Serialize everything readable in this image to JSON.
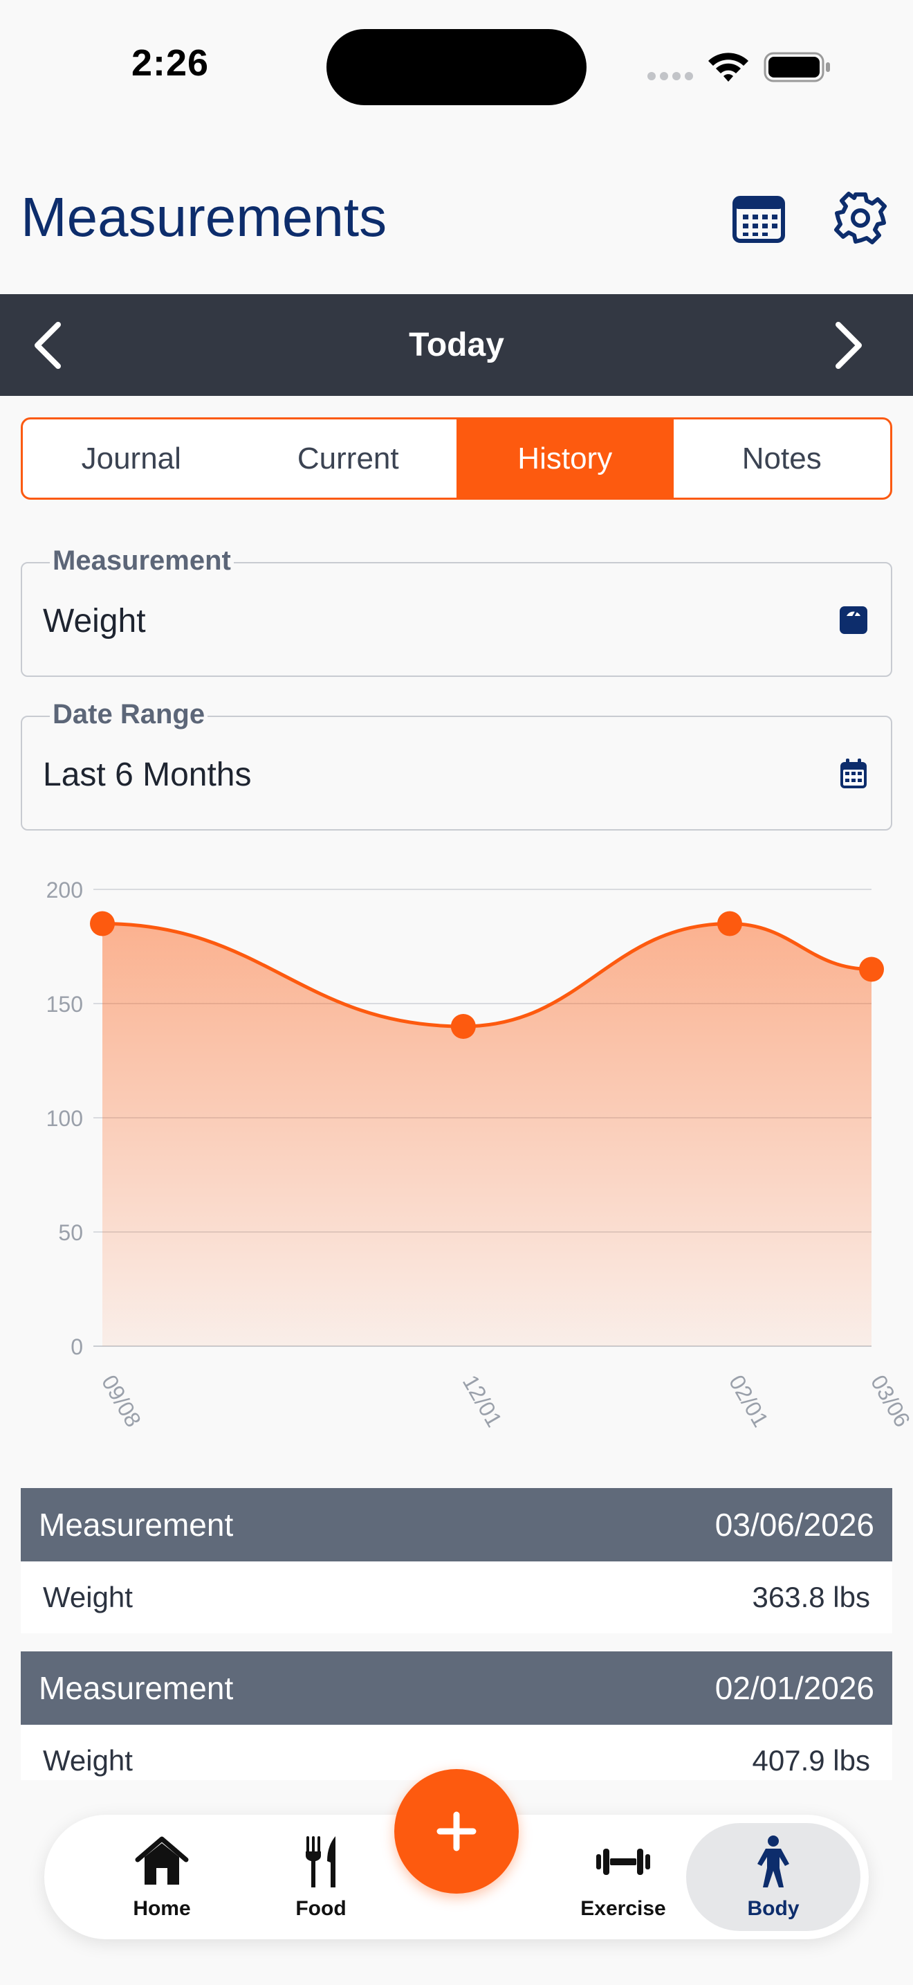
{
  "status_bar": {
    "time": "2:26"
  },
  "header": {
    "title": "Measurements",
    "calendar_icon": "calendar-icon",
    "settings_icon": "gear-icon"
  },
  "date_nav": {
    "label": "Today",
    "prev_icon": "chevron-left-icon",
    "next_icon": "chevron-right-icon"
  },
  "tabs": [
    {
      "label": "Journal",
      "active": false
    },
    {
      "label": "Current",
      "active": false
    },
    {
      "label": "History",
      "active": true
    },
    {
      "label": "Notes",
      "active": false
    }
  ],
  "fields": {
    "measurement": {
      "legend": "Measurement",
      "value": "Weight",
      "icon": "scale-icon"
    },
    "date_range": {
      "legend": "Date Range",
      "value": "Last 6 Months",
      "icon": "calendar-icon"
    }
  },
  "chart_data": {
    "type": "area",
    "x": [
      "09/08",
      "12/01",
      "02/01",
      "03/06"
    ],
    "y": [
      185,
      140,
      185,
      165
    ],
    "ylim": [
      0,
      200
    ],
    "yticks": [
      0,
      50,
      100,
      150,
      200
    ],
    "grid": true,
    "color": "#fd5a0f"
  },
  "history": [
    {
      "header_label": "Measurement",
      "date": "03/06/2026",
      "name": "Weight",
      "value": "363.8 lbs"
    },
    {
      "header_label": "Measurement",
      "date": "02/01/2026",
      "name": "Weight",
      "value": "407.9 lbs"
    }
  ],
  "bottom_nav": {
    "items": [
      {
        "label": "Home",
        "icon": "home-icon"
      },
      {
        "label": "Food",
        "icon": "fork-knife-icon"
      },
      {
        "label": "Exercise",
        "icon": "dumbbell-icon"
      },
      {
        "label": "Body",
        "icon": "person-icon",
        "active": true
      }
    ],
    "fab_icon": "plus-icon"
  },
  "colors": {
    "accent": "#fd5a0f",
    "brand": "#0d2d6c",
    "nav_bg": "#333843",
    "list_header": "#606a7a"
  }
}
